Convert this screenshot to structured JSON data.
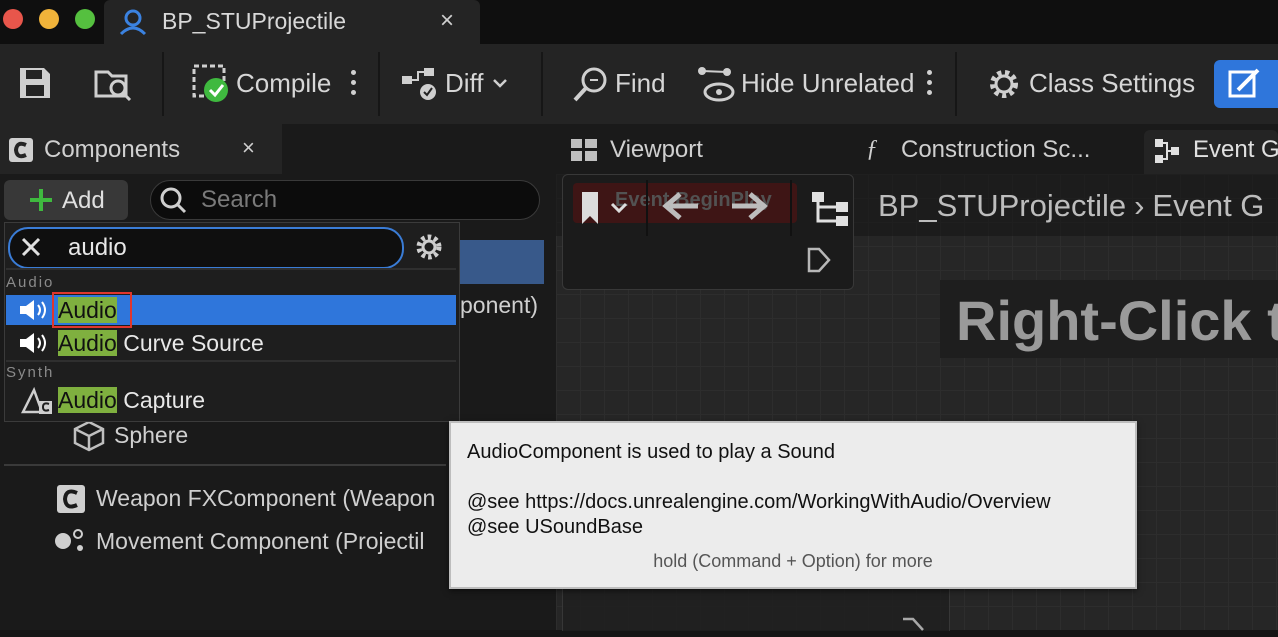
{
  "window": {
    "tab_title": "BP_STUProjectile",
    "tab_close": "×"
  },
  "toolbar": {
    "compile": "Compile",
    "diff": "Diff",
    "find": "Find",
    "hide_unrelated": "Hide Unrelated",
    "class_settings": "Class Settings"
  },
  "components_panel": {
    "tab_label": "Components",
    "close": "×",
    "add_label": "Add",
    "search_placeholder": "Search"
  },
  "add_dropdown": {
    "query": "audio",
    "categories": [
      {
        "name": "Audio",
        "items": [
          {
            "highlight": "Audio",
            "rest": ""
          },
          {
            "highlight": "Audio",
            "rest": " Curve Source"
          }
        ]
      },
      {
        "name": "Synth",
        "items": [
          {
            "highlight": "Audio",
            "rest": " Capture"
          }
        ]
      }
    ],
    "behind_text": "ponent)"
  },
  "tree": {
    "items": [
      "Sphere",
      "Weapon FXComponent (Weapon",
      "Movement Component (Projectil"
    ]
  },
  "graph_tabs": {
    "viewport": "Viewport",
    "construction": "Construction Sc...",
    "event_graph": "Event Gr"
  },
  "graph": {
    "node_title": "Event BeginPlay",
    "breadcrumb_root": "BP_STUProjectile",
    "breadcrumb_leaf": "Event G",
    "watermark": "Right-Click to"
  },
  "tooltip": {
    "line1": "AudioComponent is used to play a Sound",
    "line2": "@see https://docs.unrealengine.com/WorkingWithAudio/Overview",
    "line3": "@see USoundBase",
    "hint": "hold (Command + Option) for more"
  },
  "colors": {
    "accent": "#2f76db",
    "match_highlight": "#7fb03f",
    "selection_box": "#e0362c",
    "compile_ok": "#3fb93f"
  }
}
